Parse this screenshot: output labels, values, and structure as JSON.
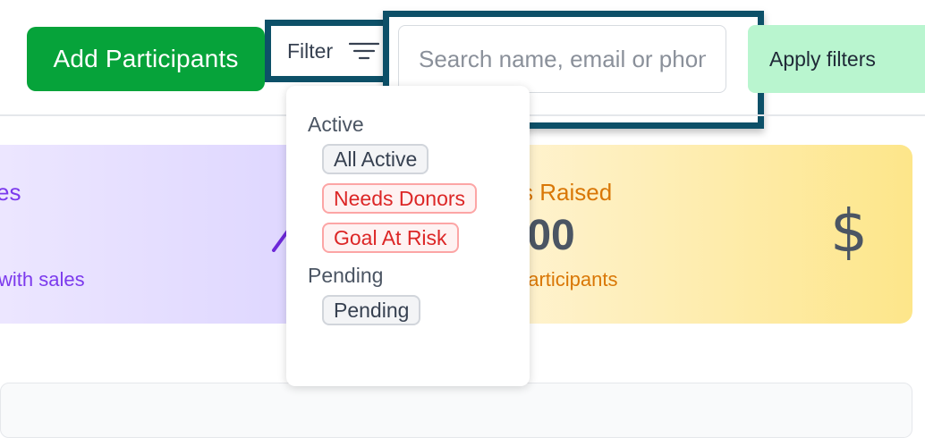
{
  "toolbar": {
    "add_label": "Add Participants",
    "filter_label": "Filter",
    "search_placeholder": "Search name, email or phone",
    "apply_label": "Apply filters"
  },
  "cards": {
    "sales": {
      "title": "es",
      "subtitle": "with sales"
    },
    "raised": {
      "title": "ss Raised",
      "value": ".00",
      "subtitle": "participants"
    }
  },
  "filter_menu": {
    "sections": [
      {
        "label": "Active",
        "options": [
          "All Active",
          "Needs Donors",
          "Goal At Risk"
        ]
      },
      {
        "label": "Pending",
        "options": [
          "Pending"
        ]
      }
    ]
  },
  "colors": {
    "primary_green": "#06a33a",
    "highlight_frame": "#0d5068",
    "danger_red": "#dc2626",
    "sales_purple": "#7c3aed",
    "raised_amber": "#d97706"
  },
  "icons": {
    "filter": "filter-lines-icon",
    "trend": "trend-up-icon",
    "dollar": "dollar-icon"
  }
}
